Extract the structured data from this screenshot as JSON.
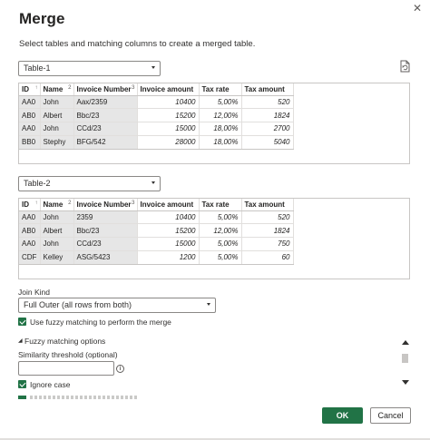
{
  "dialog": {
    "title": "Merge",
    "close_glyph": "✕",
    "subtitle": "Select tables and matching columns to create a merged table."
  },
  "table1": {
    "selected": "Table-1",
    "columns": [
      {
        "label": "ID",
        "sort": "↑"
      },
      {
        "label": "Name",
        "sort": "2"
      },
      {
        "label": "Invoice Number",
        "sort": "3"
      },
      {
        "label": "Invoice amount",
        "sort": ""
      },
      {
        "label": "Tax rate",
        "sort": ""
      },
      {
        "label": "Tax amount",
        "sort": ""
      }
    ],
    "rows": [
      [
        "AA0",
        "John",
        "Aax/2359",
        "10400",
        "5,00%",
        "520"
      ],
      [
        "AB0",
        "Albert",
        "Bbc/23",
        "15200",
        "12,00%",
        "1824"
      ],
      [
        "AA0",
        "John",
        "CCd/23",
        "15000",
        "18,00%",
        "2700"
      ],
      [
        "BB0",
        "Stephy",
        "BFG/542",
        "28000",
        "18,00%",
        "5040"
      ]
    ]
  },
  "table2": {
    "selected": "Table-2",
    "columns": [
      {
        "label": "ID",
        "sort": "↑"
      },
      {
        "label": "Name",
        "sort": "2"
      },
      {
        "label": "Invoice Number",
        "sort": "3"
      },
      {
        "label": "Invoice amount",
        "sort": ""
      },
      {
        "label": "Tax rate",
        "sort": ""
      },
      {
        "label": "Tax amount",
        "sort": ""
      }
    ],
    "rows": [
      [
        "AA0",
        "John",
        "2359",
        "10400",
        "5,00%",
        "520"
      ],
      [
        "AB0",
        "Albert",
        "Bbc/23",
        "15200",
        "12,00%",
        "1824"
      ],
      [
        "AA0",
        "John",
        "CCd/23",
        "15000",
        "5,00%",
        "750"
      ],
      [
        "CDF",
        "Kelley",
        "ASG/5423",
        "1200",
        "5,00%",
        "60"
      ]
    ]
  },
  "join": {
    "label": "Join Kind",
    "selected": "Full Outer (all rows from both)"
  },
  "fuzzy": {
    "use_label": "Use fuzzy matching to perform the merge",
    "options_label": "Fuzzy matching options",
    "options_arrow": "◢",
    "threshold_label": "Similarity threshold (optional)",
    "threshold_value": "",
    "info_glyph": "i",
    "ignore_case_label": "Ignore case"
  },
  "buttons": {
    "ok": "OK",
    "cancel": "Cancel"
  },
  "colors": {
    "accent": "#217346",
    "selected_column_bg": "#e6e6e6"
  }
}
